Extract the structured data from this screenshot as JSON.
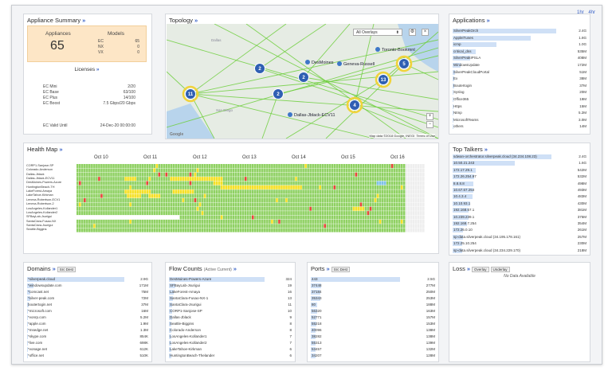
{
  "header": {
    "icon_left": "1hr",
    "icon_right": "4hr"
  },
  "appliance_summary": {
    "title": "Appliance Summary",
    "appliances_label": "Appliances",
    "appliances_count": "65",
    "models_label": "Models",
    "models": [
      {
        "name": "EC",
        "value": "65"
      },
      {
        "name": "NX",
        "value": "0"
      },
      {
        "name": "VX",
        "value": "0"
      }
    ],
    "licenses_title": "Licenses",
    "licenses": [
      {
        "name": "EC Mini",
        "value": "2/20"
      },
      {
        "name": "EC Base",
        "value": "63/100"
      },
      {
        "name": "EC Plus",
        "value": "14/100"
      },
      {
        "name": "EC Boost",
        "value": "7.5 Gbps/20 Gbps"
      }
    ],
    "valid_until_label": "EC Valid Until",
    "valid_until_value": "24-Dec-20 00:00:00"
  },
  "topology": {
    "title": "Topology",
    "overlay_select": "All Overlays",
    "map_credit": "Map data ©2018 Google, INEGI",
    "terms": "Terms of Use",
    "google": "Google",
    "city_labels": [
      "DesMoines",
      "Geneva-Russell",
      "Toronto-Bookmnt",
      "Dallas-Jblack-ECV11",
      "Dallas",
      "San Diego"
    ],
    "clusters": [
      {
        "label": "11",
        "ring": true
      },
      {
        "label": "2",
        "ring": false
      },
      {
        "label": "2",
        "ring": false
      },
      {
        "label": "2",
        "ring": false
      },
      {
        "label": "13",
        "ring": true
      },
      {
        "label": "4",
        "ring": true
      },
      {
        "label": "5",
        "ring": true
      }
    ]
  },
  "applications": {
    "title": "Applications",
    "items": [
      {
        "name": "SilverPeakOrch",
        "value": "2.4G",
        "frac": 0.93
      },
      {
        "name": "AppleiTunes",
        "value": "1.8G",
        "frac": 0.7
      },
      {
        "name": "icmp",
        "value": "1.0G",
        "frac": 0.39
      },
      {
        "name": "critical_dns",
        "value": "535M",
        "frac": 0.21
      },
      {
        "name": "SilverPeakIPSLA",
        "value": "408M",
        "frac": 0.16
      },
      {
        "name": "WindowsUpdate",
        "value": "172M",
        "frac": 0.07
      },
      {
        "name": "SilverPeakCloudPortal",
        "value": "51M",
        "frac": 0.02
      },
      {
        "name": "Ex",
        "value": "38M",
        "frac": 0.015
      },
      {
        "name": "Boutertogin",
        "value": "37M",
        "frac": 0.015
      },
      {
        "name": "Syslog",
        "value": "20M",
        "frac": 0.01
      },
      {
        "name": "Office365",
        "value": "19M",
        "frac": 0.01
      },
      {
        "name": "Https",
        "value": "15M",
        "frac": 0.01
      },
      {
        "name": "Ntmp",
        "value": "5.2M",
        "frac": 0.005
      },
      {
        "name": "MicrosoftTeams",
        "value": "3.0M",
        "frac": 0.004
      },
      {
        "name": "others",
        "value": "14M",
        "frac": 0.006
      }
    ]
  },
  "health_map": {
    "title": "Health Map",
    "dates": [
      "Oct 10",
      "Oct 11",
      "Oct 12",
      "Oct 13",
      "Oct 14",
      "Oct 15",
      "Oct 16"
    ],
    "rows": [
      "CORP1-Sanjose-SP",
      "Colorado-Anderson",
      "Dallas-Jblack",
      "Dallas-Jblack-ECV11",
      "DesMoines-Powers-Azure",
      "HuntingtonBeach-TH",
      "LakeForest-Amaya",
      "LakeTahoe-Kirkman",
      "Lenexa-Robertson-ECV1",
      "Lenexa-Robertson-2",
      "LosAngeles-Kollander1",
      "LosAngeles-Kollander2",
      "SFBayLab-Jsurigui",
      "SantaClara-Fusao-NX",
      "SantaClara-Jsurigui",
      "Seattle-Biggins"
    ]
  },
  "top_talkers": {
    "title": "Top Talkers",
    "items": [
      {
        "name": "sdwan-orchestrator.silverpeak.cloud (34.234.108.23)",
        "value": "2.4G",
        "frac": 0.95
      },
      {
        "name": "10.50.21.243",
        "value": "1.6G",
        "frac": 0.6
      },
      {
        "name": "172.17.29.1",
        "value": "542M",
        "frac": 0.22
      },
      {
        "name": "172.26.254.97",
        "value": "532M",
        "frac": 0.21
      },
      {
        "name": "8.8.8.8",
        "value": "498M",
        "frac": 0.2
      },
      {
        "name": "10.67.67.254",
        "value": "493M",
        "frac": 0.2
      },
      {
        "name": "10.4.3.4",
        "value": "483M",
        "frac": 0.19
      },
      {
        "name": "10.10.93.1",
        "value": "430M",
        "frac": 0.17
      },
      {
        "name": "192.168.67.1",
        "value": "381M",
        "frac": 0.15
      },
      {
        "name": "10.239.239.1",
        "value": "375M",
        "frac": 0.15
      },
      {
        "name": "192.168.7.254",
        "value": "354M",
        "frac": 0.14
      },
      {
        "name": "172.26.0.10",
        "value": "261M",
        "frac": 0.1
      },
      {
        "name": "sp-data.silverpeak.cloud (34.195.178.161)",
        "value": "257M",
        "frac": 0.1
      },
      {
        "name": "172.25.10.254",
        "value": "230M",
        "frac": 0.09
      },
      {
        "name": "sp-data.silverpeak.cloud (34.234.229.170)",
        "value": "218M",
        "frac": 0.09
      }
    ]
  },
  "domains": {
    "title": "Domains",
    "button": "Src Dest",
    "items": [
      {
        "name": "*silverpeak.cloud",
        "value": "2.9G",
        "frac": 0.95
      },
      {
        "name": "*windowsupdate.com",
        "value": "171M",
        "frac": 0.06
      },
      {
        "name": "*comcast.net",
        "value": "75M",
        "frac": 0.03
      },
      {
        "name": "*silver-peak.com",
        "value": "72M",
        "frac": 0.03
      },
      {
        "name": "boutertogin.net",
        "value": "37M",
        "frac": 0.015
      },
      {
        "name": "*microsoft.com",
        "value": "16M",
        "frac": 0.008
      },
      {
        "name": "*vonrp.com",
        "value": "5.2M",
        "frac": 0.004
      },
      {
        "name": "*apple.com",
        "value": "1.9M",
        "frac": 0.003
      },
      {
        "name": "*msedge.net",
        "value": "1.3M",
        "frac": 0.003
      },
      {
        "name": "*skype.com",
        "value": "854K",
        "frac": 0.002
      },
      {
        "name": "*live.com",
        "value": "698K",
        "frac": 0.002
      },
      {
        "name": "*vonage.net",
        "value": "612K",
        "frac": 0.002
      },
      {
        "name": "*office.net",
        "value": "510K",
        "frac": 0.002
      }
    ]
  },
  "flow_counts": {
    "title": "Flow Counts",
    "subtitle": "(Active Current)",
    "items": [
      {
        "name": "DesMoines-Powers-Azure",
        "value": "324",
        "frac": 0.95
      },
      {
        "name": "SFBayLab-Jsurigui",
        "value": "19",
        "frac": 0.06
      },
      {
        "name": "LakeForest-Amaya",
        "value": "16",
        "frac": 0.05
      },
      {
        "name": "SantaClara-Fusao-NX-1",
        "value": "13",
        "frac": 0.04
      },
      {
        "name": "SantaClara-Jsurigui",
        "value": "11",
        "frac": 0.035
      },
      {
        "name": "CORP1-Sanjose-SP",
        "value": "10",
        "frac": 0.03
      },
      {
        "name": "Dallas-Jblack",
        "value": "9",
        "frac": 0.03
      },
      {
        "name": "Seattle-Biggins",
        "value": "8",
        "frac": 0.025
      },
      {
        "name": "Colorado-Anderson",
        "value": "8",
        "frac": 0.025
      },
      {
        "name": "LosAngeles-Kollander1",
        "value": "7",
        "frac": 0.02
      },
      {
        "name": "LosAngeles-Kollander2",
        "value": "7",
        "frac": 0.02
      },
      {
        "name": "LakeTahoe-Kirkman",
        "value": "6",
        "frac": 0.02
      },
      {
        "name": "HuntingtonBeach-Thelander",
        "value": "6",
        "frac": 0.02
      }
    ]
  },
  "ports": {
    "title": "Ports",
    "button": "Src Dest",
    "items": [
      {
        "name": "443",
        "value": "2.5G",
        "frac": 0.95
      },
      {
        "name": "37448",
        "value": "277M",
        "frac": 0.11
      },
      {
        "name": "37184",
        "value": "250M",
        "frac": 0.1
      },
      {
        "name": "35343",
        "value": "253M",
        "frac": 0.1
      },
      {
        "name": "80",
        "value": "188M",
        "frac": 0.07
      },
      {
        "name": "56320",
        "value": "163M",
        "frac": 0.065
      },
      {
        "name": "52771",
        "value": "157M",
        "frac": 0.06
      },
      {
        "name": "55218",
        "value": "153M",
        "frac": 0.06
      },
      {
        "name": "40096",
        "value": "138M",
        "frac": 0.055
      },
      {
        "name": "38282",
        "value": "138M",
        "frac": 0.055
      },
      {
        "name": "55313",
        "value": "139M",
        "frac": 0.055
      },
      {
        "name": "53457",
        "value": "132M",
        "frac": 0.05
      },
      {
        "name": "34207",
        "value": "128M",
        "frac": 0.05
      }
    ]
  },
  "loss": {
    "title": "Loss",
    "tabs": [
      "Overlay",
      "Underlay"
    ],
    "no_data": "No Data Available"
  }
}
